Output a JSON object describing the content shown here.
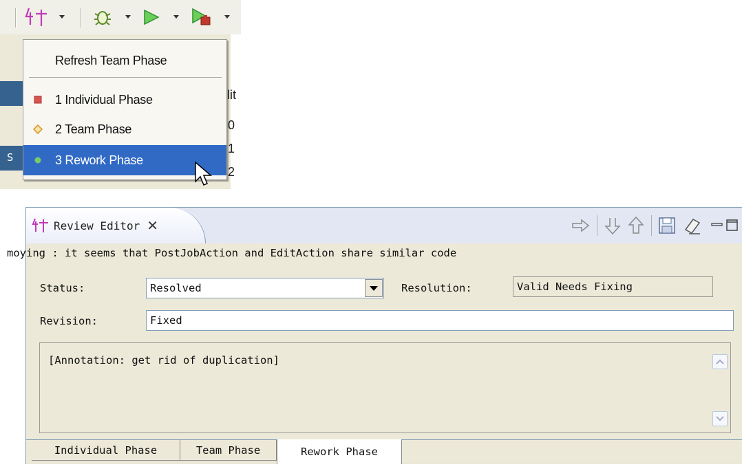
{
  "menu": {
    "refresh_label": "Refresh Team Phase",
    "items": [
      {
        "label": "1 Individual Phase",
        "icon": "red-square-icon",
        "color": "#d9534f"
      },
      {
        "label": "2 Team Phase",
        "icon": "orange-diamond-icon",
        "color": "#e8a23a"
      },
      {
        "label": "3 Rework Phase",
        "icon": "green-dot-icon",
        "color": "#7cc96a",
        "selected": true
      }
    ]
  },
  "background_fragments": {
    "col_letters": "lit",
    "digits": [
      "0",
      "1",
      "2"
    ],
    "left_letter": "S"
  },
  "editor": {
    "tab_title": "Review Editor",
    "description": "moying : it seems that PostJobAction and EditAction share similar code",
    "status_label": "Status:",
    "status_value": "Resolved",
    "resolution_label": "Resolution:",
    "resolution_value": "Valid Needs Fixing",
    "revision_label": "Revision:",
    "revision_value": "Fixed",
    "annotation_text": "[Annotation:  get rid of duplication]",
    "phase_tabs": [
      "Individual Phase",
      "Team Phase",
      "Rework Phase"
    ],
    "active_phase_tab": "Rework Phase"
  },
  "colors": {
    "selection": "#316ac5",
    "plugin_icon": "#c03ab8",
    "run_icon": "#3fae3f"
  }
}
